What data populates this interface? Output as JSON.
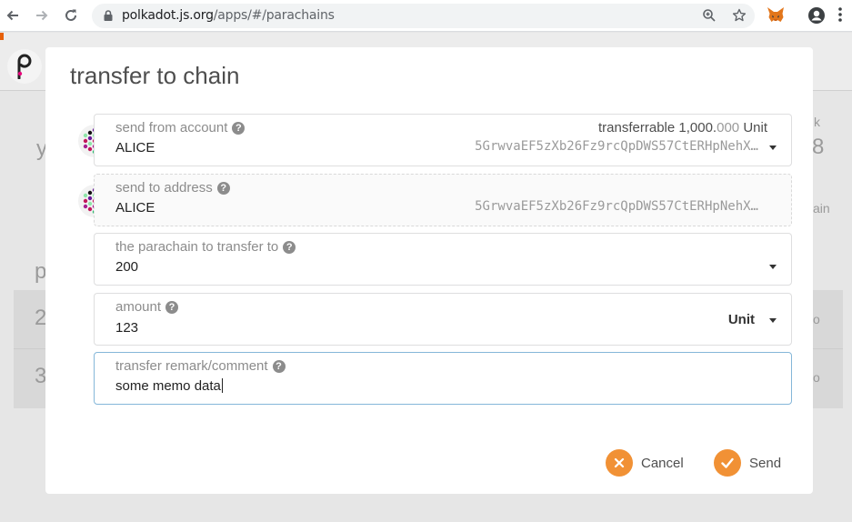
{
  "browser": {
    "url_host": "polkadot.js.org",
    "url_path": "/apps/#/parachains"
  },
  "background": {
    "frag_y": "y",
    "frag_k": "k",
    "frag_8": "8",
    "frag_ain": "ain",
    "frag_p": "p",
    "frag_2": "2",
    "frag_3": "3",
    "frag_o1": "o",
    "frag_o2": "o"
  },
  "modal": {
    "title": "transfer to chain",
    "from": {
      "label": "send from account",
      "name": "ALICE",
      "address": "5GrwvaEF5zXb26Fz9rcQpDWS57CtERHpNehX…",
      "transferrable_label": "transferrable",
      "transferrable_int": "1,000.",
      "transferrable_dec": "000",
      "transferrable_unit": "Unit"
    },
    "to": {
      "label": "send to address",
      "name": "ALICE",
      "address": "5GrwvaEF5zXb26Fz9rcQpDWS57CtERHpNehX…"
    },
    "parachain": {
      "label": "the parachain to transfer to",
      "value": "200"
    },
    "amount": {
      "label": "amount",
      "value": "123",
      "unit": "Unit"
    },
    "remark": {
      "label": "transfer remark/comment",
      "value": "some memo data"
    },
    "buttons": {
      "cancel": "Cancel",
      "send": "Send"
    },
    "help_glyph": "?"
  },
  "colors": {
    "accent": "#f19135",
    "focus": "#85b7d9"
  }
}
